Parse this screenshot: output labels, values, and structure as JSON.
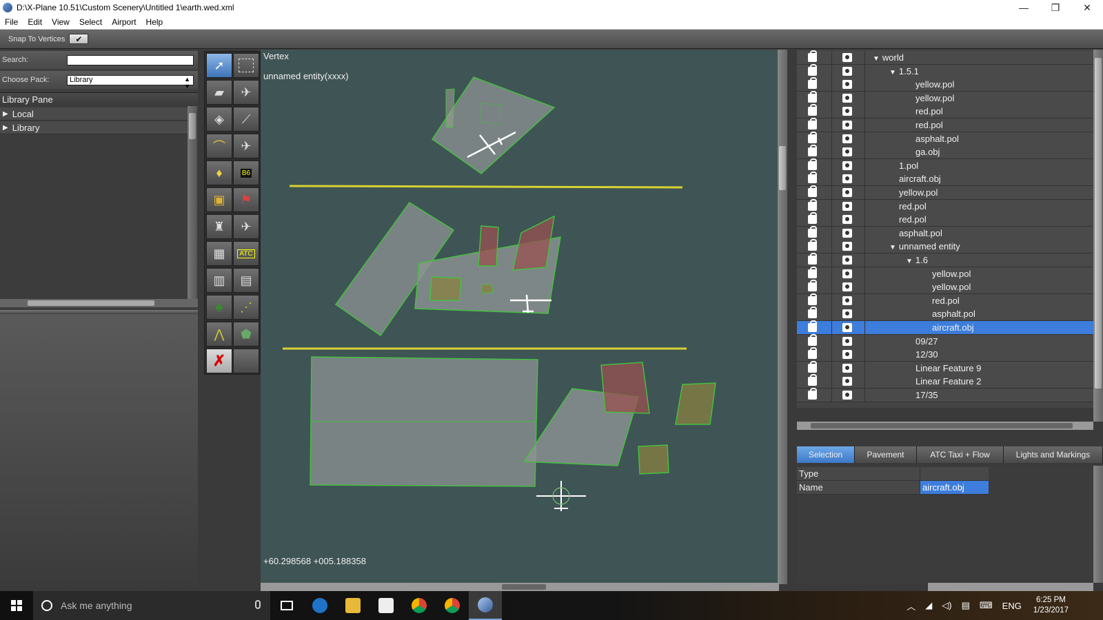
{
  "window": {
    "title": "D:\\X-Plane 10.51\\Custom Scenery\\Untitled 1\\earth.wed.xml",
    "minimize": "—",
    "maximize": "❐",
    "close": "✕"
  },
  "menu": [
    "File",
    "Edit",
    "View",
    "Select",
    "Airport",
    "Help"
  ],
  "toolbar": {
    "snap_label": "Snap To Vertices",
    "snap_checked": "✔"
  },
  "library": {
    "search_label": "Search:",
    "search_value": "",
    "pack_label": "Choose Pack:",
    "pack_value": "Library",
    "header": "Library Pane",
    "items": [
      {
        "label": "Local"
      },
      {
        "label": "Library"
      }
    ]
  },
  "map": {
    "tool_label": "Vertex",
    "entity_label": "unnamed entity(xxxx)",
    "coordinates": "+60.298568 +005.188358"
  },
  "hierarchy": {
    "rows": [
      {
        "label": "world",
        "depth": 0,
        "expanded": true
      },
      {
        "label": "1.5.1",
        "depth": 1,
        "expanded": true
      },
      {
        "label": "yellow.pol",
        "depth": 2
      },
      {
        "label": "yellow.pol",
        "depth": 2
      },
      {
        "label": "red.pol",
        "depth": 2
      },
      {
        "label": "red.pol",
        "depth": 2
      },
      {
        "label": "asphalt.pol",
        "depth": 2
      },
      {
        "label": "ga.obj",
        "depth": 2
      },
      {
        "label": "1.pol",
        "depth": 1
      },
      {
        "label": "aircraft.obj",
        "depth": 1
      },
      {
        "label": "yellow.pol",
        "depth": 1
      },
      {
        "label": "red.pol",
        "depth": 1
      },
      {
        "label": "red.pol",
        "depth": 1
      },
      {
        "label": "asphalt.pol",
        "depth": 1
      },
      {
        "label": "unnamed entity",
        "depth": 1,
        "expanded": true
      },
      {
        "label": "1.6",
        "depth": 2,
        "expanded": true
      },
      {
        "label": "yellow.pol",
        "depth": 3
      },
      {
        "label": "yellow.pol",
        "depth": 3
      },
      {
        "label": "red.pol",
        "depth": 3
      },
      {
        "label": "asphalt.pol",
        "depth": 3
      },
      {
        "label": "aircraft.obj",
        "depth": 3,
        "selected": true
      },
      {
        "label": "09/27",
        "depth": 2
      },
      {
        "label": "12/30",
        "depth": 2
      },
      {
        "label": "Linear Feature 9",
        "depth": 2
      },
      {
        "label": "Linear Feature 2",
        "depth": 2
      },
      {
        "label": "17/35",
        "depth": 2
      }
    ]
  },
  "tabs": [
    {
      "label": "Selection",
      "active": true
    },
    {
      "label": "Pavement"
    },
    {
      "label": "ATC Taxi + Flow"
    },
    {
      "label": "Lights and Markings"
    }
  ],
  "properties": [
    {
      "key": "Type",
      "value": ""
    },
    {
      "key": "Name",
      "value": "aircraft.obj",
      "selected": true
    }
  ],
  "taskbar": {
    "search_placeholder": "Ask me anything",
    "language": "ENG",
    "time": "6:25 PM",
    "date": "1/23/2017"
  },
  "colors": {
    "map_background": "#3f5455",
    "selection_blue": "#3d7ddb",
    "polygon_outline": "#44c040",
    "runway_line": "#d9d232"
  }
}
